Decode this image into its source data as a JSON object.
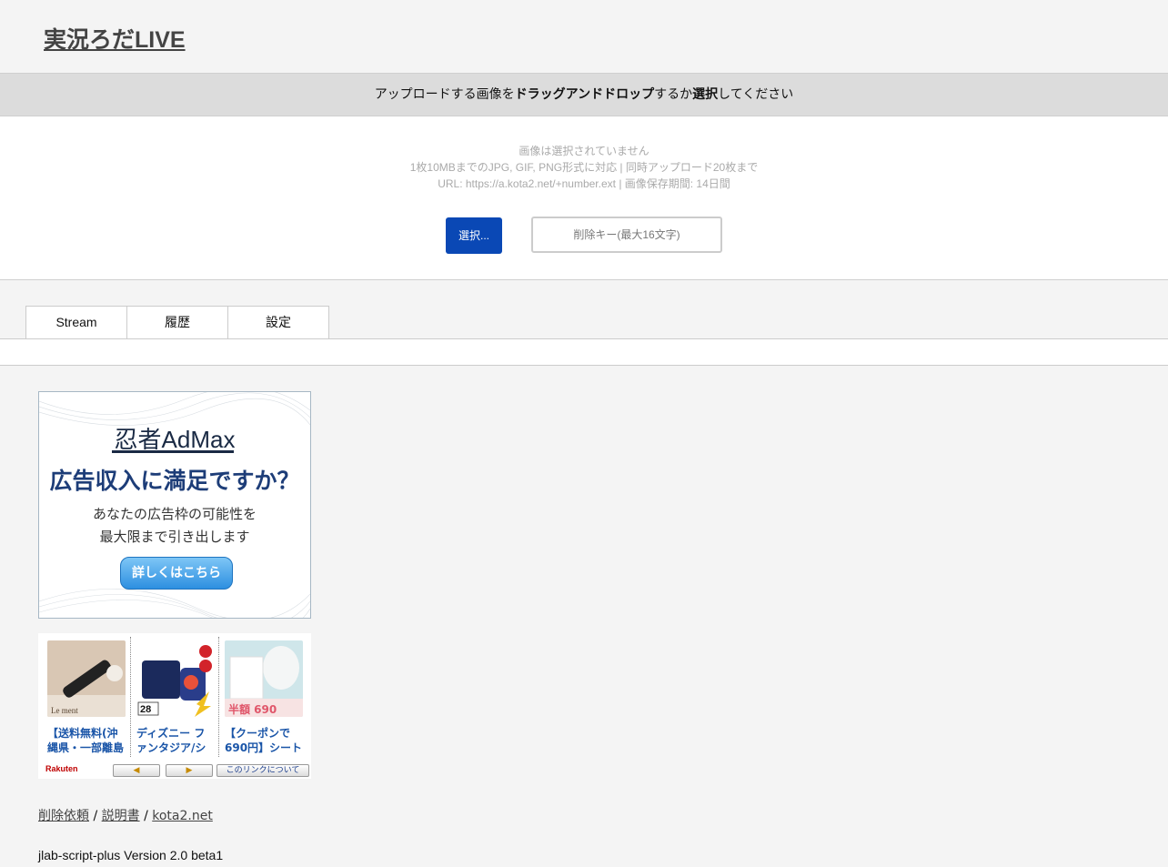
{
  "site": {
    "title": "実況ろだLIVE"
  },
  "dropbar": {
    "prefix": "アップロードする画像を",
    "drag": "ドラッグアンドドロップ",
    "middle": "するか",
    "select": "選択",
    "suffix": "してください"
  },
  "upload": {
    "status": "画像は選択されていません",
    "limits": "1枚10MBまでのJPG, GIF, PNG形式に対応 | 同時アップロード20枚まで",
    "url_info": "URL: https://a.kota2.net/+number.ext | 画像保存期間: 14日間",
    "select_button": "選択...",
    "delete_key_placeholder": "削除キー(最大16文字)"
  },
  "tabs": [
    {
      "label": "Stream"
    },
    {
      "label": "履歴"
    },
    {
      "label": "設定"
    }
  ],
  "ad_admax": {
    "brand": "忍者AdMax",
    "headline": "広告収入に満足ですか？",
    "sub_line1": "あなたの広告枠の可能性を",
    "sub_line2": "最大限まで引き出します",
    "cta": "詳しくはこちら"
  },
  "ad_rakuten": {
    "products": [
      {
        "title": "【送料無料(沖縄県・一部離島",
        "image": "hair-brush-image",
        "caption": "Le ment"
      },
      {
        "title": "ディズニー ファンタジア/シ",
        "image": "disney-set-image",
        "caption": "28"
      },
      {
        "title": "【クーポンで690円】シート",
        "image": "face-mask-image",
        "caption": "半額 690"
      }
    ],
    "logo": "Rakuten",
    "prev_icon": "left-arrow-icon",
    "next_icon": "right-arrow-icon",
    "about": "このリンクについて"
  },
  "footer": {
    "links": [
      "削除依頼",
      "説明書",
      "kota2.net"
    ],
    "separator": " / ",
    "version": "jlab-script-plus Version 2.0 beta1"
  }
}
